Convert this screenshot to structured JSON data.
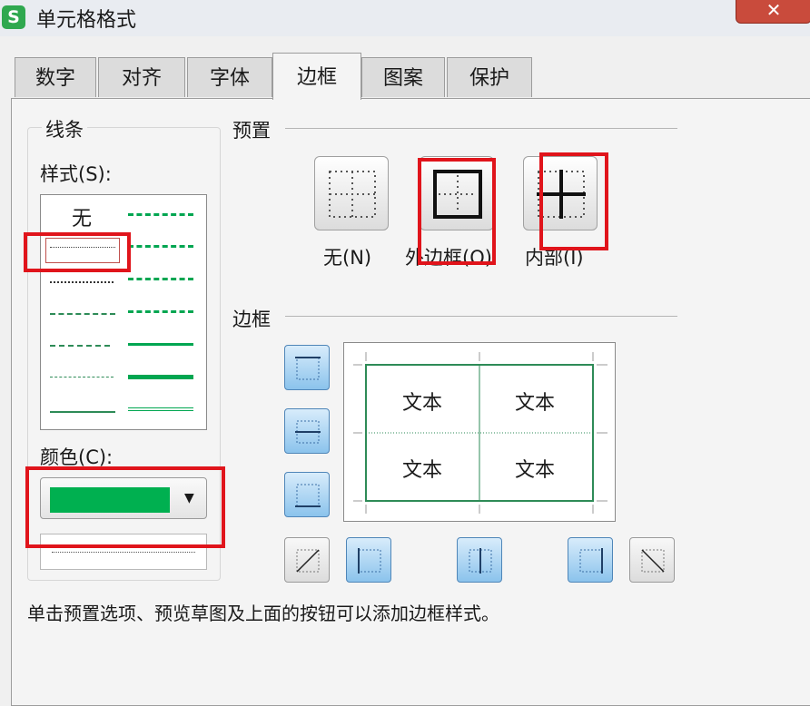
{
  "window": {
    "title": "单元格格式",
    "app_icon_letter": "S",
    "close_symbol": "✕"
  },
  "tabs": [
    {
      "label": "数字"
    },
    {
      "label": "对齐"
    },
    {
      "label": "字体"
    },
    {
      "label": "边框",
      "active": true
    },
    {
      "label": "图案"
    },
    {
      "label": "保护"
    }
  ],
  "line_group": {
    "title": "线条",
    "style_label": "样式(S):",
    "none_option": "无",
    "color_label": "颜色(C):",
    "selected_color": "#00b050"
  },
  "presets": {
    "title": "预置",
    "items": [
      {
        "label": "无(N)",
        "icon": "border-none-icon"
      },
      {
        "label": "外边框(O)",
        "icon": "border-outline-icon"
      },
      {
        "label": "内部(I)",
        "icon": "border-inside-icon"
      }
    ]
  },
  "border": {
    "title": "边框",
    "preview_cells": [
      "文本",
      "文本",
      "文本",
      "文本"
    ],
    "line_color": "#2e8b57"
  },
  "hint_text": "单击预置选项、预览草图及上面的按钮可以添加边框样式。",
  "highlight_color": "#e0141b"
}
